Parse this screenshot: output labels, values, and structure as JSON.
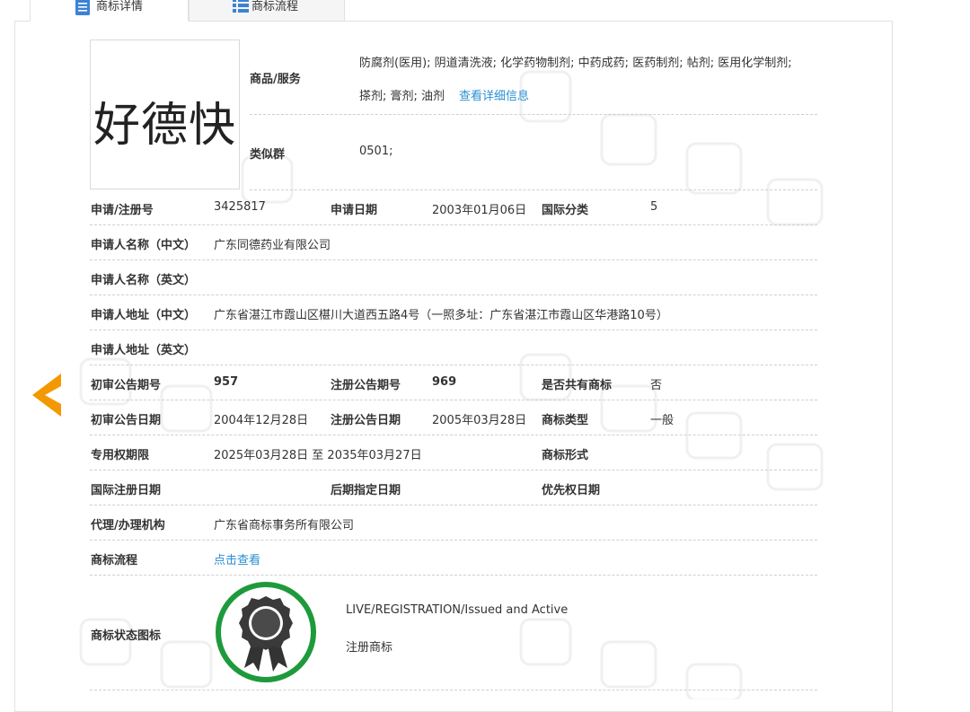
{
  "tabs": [
    {
      "label": "商标详情",
      "icon": "document-icon",
      "active": true
    },
    {
      "label": "商标流程",
      "icon": "list-icon",
      "active": false
    }
  ],
  "logo": {
    "text": "好德快"
  },
  "goods": {
    "label": "商品/服务",
    "line1": "防腐剂(医用); 阴道清洗液; 化学药物制剂; 中药成药; 医药制剂; 帖剂; 医用化学制剂;",
    "line2": "搽剂; 膏剂; 油剂",
    "detail_link": "查看详细信息"
  },
  "similar_group": {
    "label": "类似群",
    "value": "0501;"
  },
  "rows": {
    "reg_no": {
      "label": "申请/注册号",
      "value": "3425817"
    },
    "apply_date": {
      "label": "申请日期",
      "value": "2003年01月06日"
    },
    "intl_class": {
      "label": "国际分类",
      "value": "5"
    },
    "applicant_cn": {
      "label": "申请人名称（中文）",
      "value": "广东同德药业有限公司"
    },
    "applicant_en": {
      "label": "申请人名称（英文）",
      "value": ""
    },
    "address_cn": {
      "label": "申请人地址（中文）",
      "value": "广东省湛江市霞山区椹川大道西五路4号（一照多址：广东省湛江市霞山区华港路10号）"
    },
    "address_en": {
      "label": "申请人地址（英文）",
      "value": ""
    },
    "prelim_no": {
      "label": "初审公告期号",
      "value": "957"
    },
    "reg_pub_no": {
      "label": "注册公告期号",
      "value": "969"
    },
    "shared": {
      "label": "是否共有商标",
      "value": "否"
    },
    "prelim_date": {
      "label": "初审公告日期",
      "value": "2004年12月28日"
    },
    "reg_pub_date": {
      "label": "注册公告日期",
      "value": "2005年03月28日"
    },
    "mark_type": {
      "label": "商标类型",
      "value": "一般"
    },
    "exclusive_period": {
      "label": "专用权期限",
      "value": "2025年03月28日 至 2035年03月27日"
    },
    "mark_form": {
      "label": "商标形式",
      "value": ""
    },
    "intl_reg_date": {
      "label": "国际注册日期",
      "value": ""
    },
    "later_designation": {
      "label": "后期指定日期",
      "value": ""
    },
    "priority_date": {
      "label": "优先权日期",
      "value": ""
    },
    "agency": {
      "label": "代理/办理机构",
      "value": "广东省商标事务所有限公司"
    },
    "process": {
      "label": "商标流程",
      "link": "点击查看"
    }
  },
  "status": {
    "label": "商标状态图标",
    "line1": "LIVE/REGISTRATION/Issued and Active",
    "line2": "注册商标",
    "icon": "registered-badge-icon",
    "ring_color": "#1e9a3c"
  },
  "colors": {
    "accent": "#f39800",
    "link": "#2a8fd4"
  }
}
